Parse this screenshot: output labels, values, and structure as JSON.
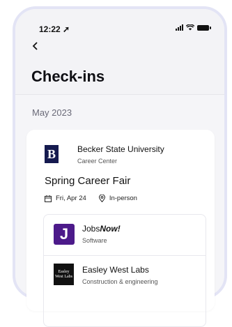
{
  "status": {
    "time": "12:22"
  },
  "header": {
    "back_icon": "chevron-left-icon",
    "title": "Check-ins"
  },
  "month": "May 2023",
  "checkin": {
    "org_logo_letter": "B",
    "org_name": "Becker State University",
    "org_sub": "Career Center",
    "event_title": "Spring Career Fair",
    "date": "Fri, Apr 24",
    "mode": "In-person",
    "employers": [
      {
        "logo": "J",
        "name_prefix": "Jobs",
        "name_suffix": "Now!",
        "category": "Software",
        "logo_color": "#4c1a8a"
      },
      {
        "logo_text": "Easley West Labs",
        "name": "Easley West Labs",
        "category": "Construction & engineering",
        "logo_color": "#111111"
      }
    ]
  }
}
